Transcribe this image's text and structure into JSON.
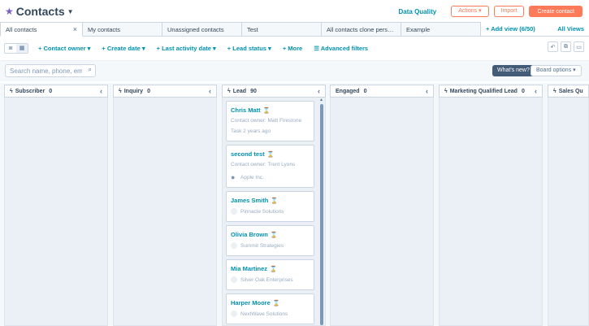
{
  "header": {
    "title": "Contacts",
    "data_quality": "Data Quality",
    "actions": "Actions",
    "import": "Import",
    "create": "Create contact",
    "accent": "#ff7a59"
  },
  "tabs": [
    {
      "label": "All contacts",
      "active": true
    },
    {
      "label": "My contacts"
    },
    {
      "label": "Unassigned contacts"
    },
    {
      "label": "Test"
    },
    {
      "label": "All contacts clone personali..."
    },
    {
      "label": "Example"
    }
  ],
  "add_view": "Add view (6/50)",
  "all_views": "All Views",
  "filters": {
    "owner": "Contact owner",
    "create_date": "Create date",
    "last_activity": "Last activity date",
    "lead_status": "Lead status",
    "more": "More",
    "advanced": "Advanced filters"
  },
  "search": {
    "placeholder": "Search name, phone, emc"
  },
  "whats_new": "What's new?",
  "board_options": "Board options",
  "columns": [
    {
      "label": "Subscriber",
      "count": "0"
    },
    {
      "label": "Inquiry",
      "count": "0"
    },
    {
      "label": "Lead",
      "count": "90"
    },
    {
      "label": "Engaged",
      "count": "0"
    },
    {
      "label": "Marketing Qualified Lead",
      "count": "0"
    },
    {
      "label": "Sales Qu",
      "count": ""
    }
  ],
  "cards": [
    {
      "name": "Chris Matt",
      "sub": "Contact owner: Matt Firestone",
      "meta": "Task 2 years ago"
    },
    {
      "name": "second test",
      "sub": "Contact owner: Trent Lyons",
      "company": "Apple Inc."
    },
    {
      "name": "James Smith",
      "company": "Pinnacle Solutions"
    },
    {
      "name": "Olivia Brown",
      "company": "Summit Strategies"
    },
    {
      "name": "Mia Martinez",
      "company": "Silver Oak Enterprises"
    },
    {
      "name": "Harper Moore",
      "company": "NextWave Solutions"
    }
  ]
}
